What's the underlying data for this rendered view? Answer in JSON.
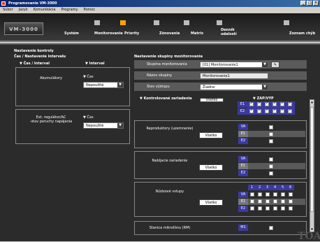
{
  "window": {
    "title": "Programovanie VM-3000",
    "controls": [
      "_",
      "□",
      "×"
    ]
  },
  "menu": [
    "Súbor",
    "Jazyk",
    "Komunikácia",
    "Programy",
    "Pomoc"
  ],
  "nav": {
    "logo": "VM-3000",
    "tabs": [
      {
        "label": "Systém",
        "active": false
      },
      {
        "label": "Monitorovanie",
        "active": true
      },
      {
        "label": "Priority",
        "active": false
      },
      {
        "label": "Zónovanie",
        "active": false
      },
      {
        "label": "Matrix",
        "active": false
      },
      {
        "label": "Denník",
        "label2": "udalostí",
        "active": false
      },
      {
        "label": "Zoznam chýb",
        "active": false
      }
    ]
  },
  "left": {
    "heading": "Nastavenie kontroly",
    "subheading": "Čas / Nastavenie intervalu",
    "col1": "▼ Čas / Interval",
    "col2": "▼ Interval",
    "group1": {
      "label": "Akumulátory",
      "field_label": "▼ Čas",
      "value": "Nepoužité"
    },
    "group2": {
      "label": "Ext. regulátor/AC",
      "label2": "-stav poruchy napájania",
      "field_label": "▼ Čas",
      "value": "Nepoužité"
    }
  },
  "right": {
    "heading": "Nastavenie skupiny monitorovania",
    "group_label": "Skupina monitorovania",
    "group_value": "[01] Monitorovanie1",
    "name_label": "Názov skupiny",
    "name_value": "Monitorovanie1",
    "output_label": "Stav výstupu",
    "output_value": "Žiadne",
    "devices_label": "▼ Kontrolované zariadenia",
    "zap_label": "▼ ZAP/VYP",
    "clear_label": "Všetko",
    "sections": [
      {
        "label": "",
        "button": "Vsetko",
        "rows": [
          "E1",
          "E2"
        ]
      },
      {
        "label": "Reproduktory (uzemnenie)",
        "button": "Všetko",
        "rows": [
          "VA",
          "E1",
          "E2"
        ]
      },
      {
        "label": "Nabíjacie zariadenie",
        "button": "Všetko",
        "rows": [
          "VA",
          "E1",
          "E2"
        ]
      },
      {
        "label": "Núdzové vstupy",
        "button": "Všetko",
        "rows": [
          "VA",
          "E1",
          "E2"
        ],
        "headers": [
          "1",
          "2",
          "3",
          "4",
          "5",
          "6"
        ]
      },
      {
        "label": "Stanica mikrofónu (RM)",
        "rows": [
          "M1"
        ]
      }
    ]
  },
  "brand": "TOA"
}
